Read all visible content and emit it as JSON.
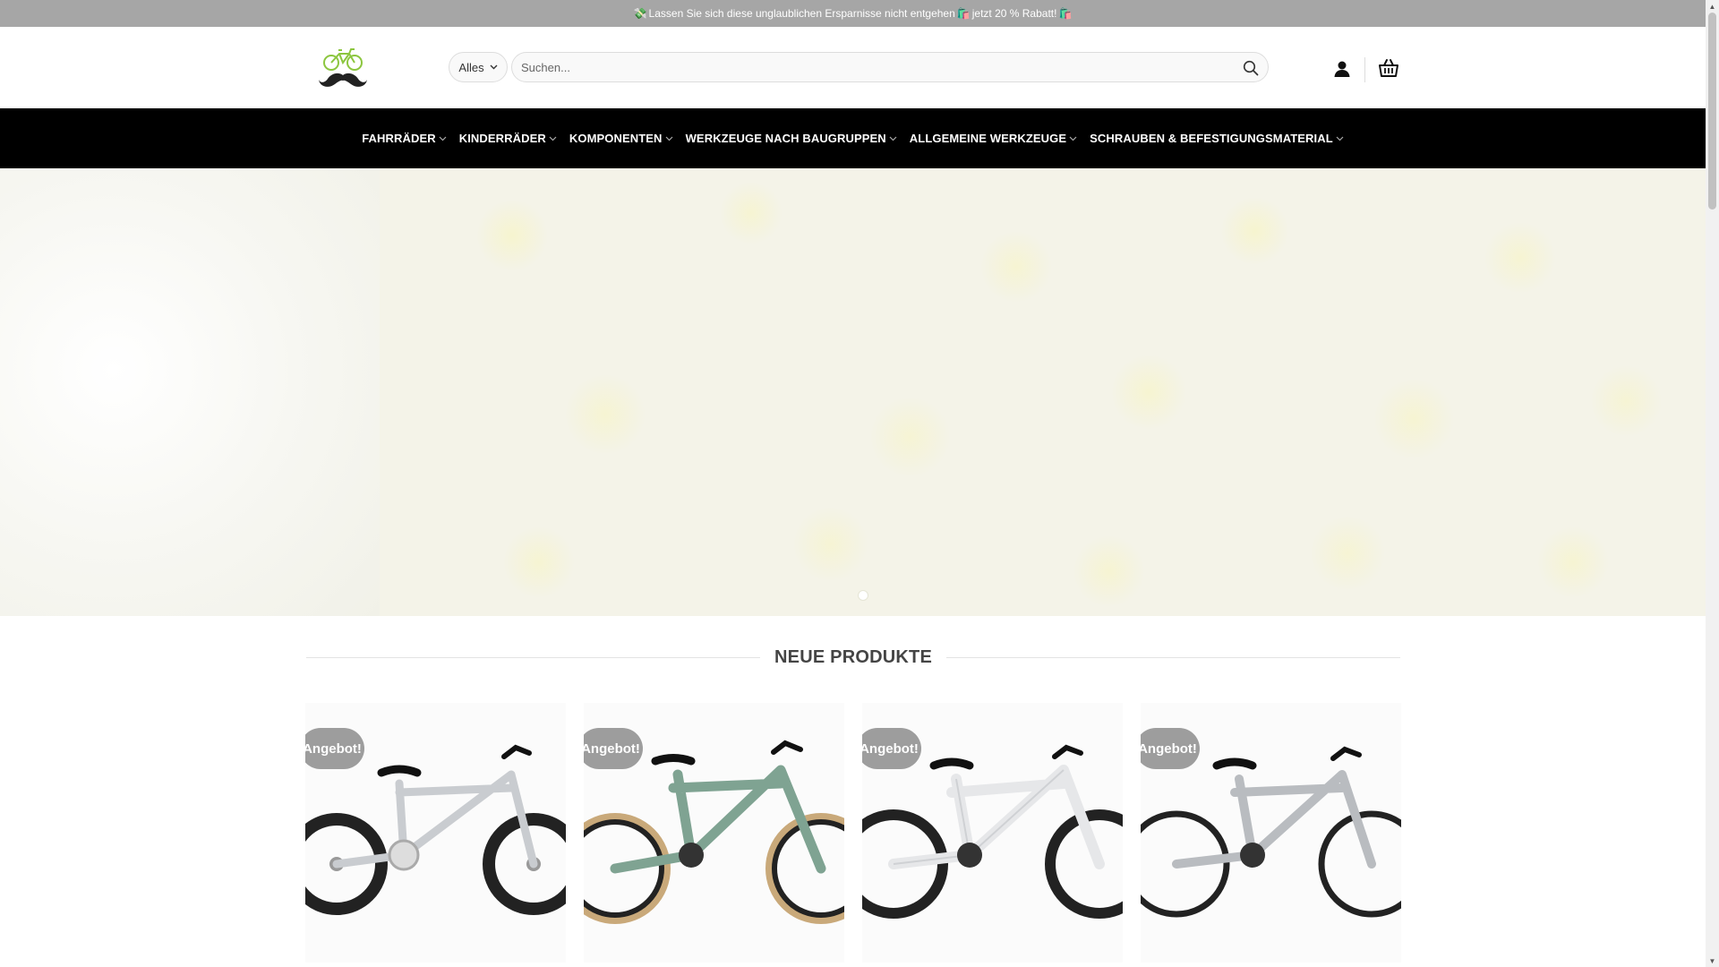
{
  "announcement": {
    "emoji_start": "💸",
    "text_1": " Lassen Sie sich diese unglaublichen Ersparnisse nicht entgehen",
    "emoji_mid": "🛍️",
    "text_2": " jetzt 20 % Rabatt! ",
    "emoji_end": "🛍️"
  },
  "header": {
    "logo_icon": "bicycle-mustache-logo",
    "search": {
      "category_value": "Alles",
      "placeholder": "Suchen...",
      "search_icon": "search-icon"
    },
    "account_icon": "user-icon",
    "cart_icon": "basket-icon"
  },
  "nav": {
    "items": [
      {
        "label": "FAHRRÄDER"
      },
      {
        "label": "KINDERRÄDER"
      },
      {
        "label": "KOMPONENTEN"
      },
      {
        "label": "WERKZEUGE NACH BAUGRUPPEN"
      },
      {
        "label": "ALLGEMEINE WERKZEUGE"
      },
      {
        "label": "SCHRAUBEN & BEFESTIGUNGSMATERIAL"
      }
    ]
  },
  "hero": {
    "active_slide": 1
  },
  "section": {
    "title": "NEUE PRODUKTE"
  },
  "products": [
    {
      "badge": "Angebot!",
      "frame_color": "#c9ccd0"
    },
    {
      "badge": "Angebot!",
      "frame_color": "#7fa392"
    },
    {
      "badge": "Angebot!",
      "frame_color": "#e6e7e9"
    },
    {
      "badge": "Angebot!",
      "frame_color": "#b9bcc0"
    }
  ],
  "colors": {
    "topbar_bg": "#a6a6a6",
    "nav_bg": "#000000",
    "badge_bg": "#9d9d9d",
    "logo_green": "#8cc63f"
  }
}
